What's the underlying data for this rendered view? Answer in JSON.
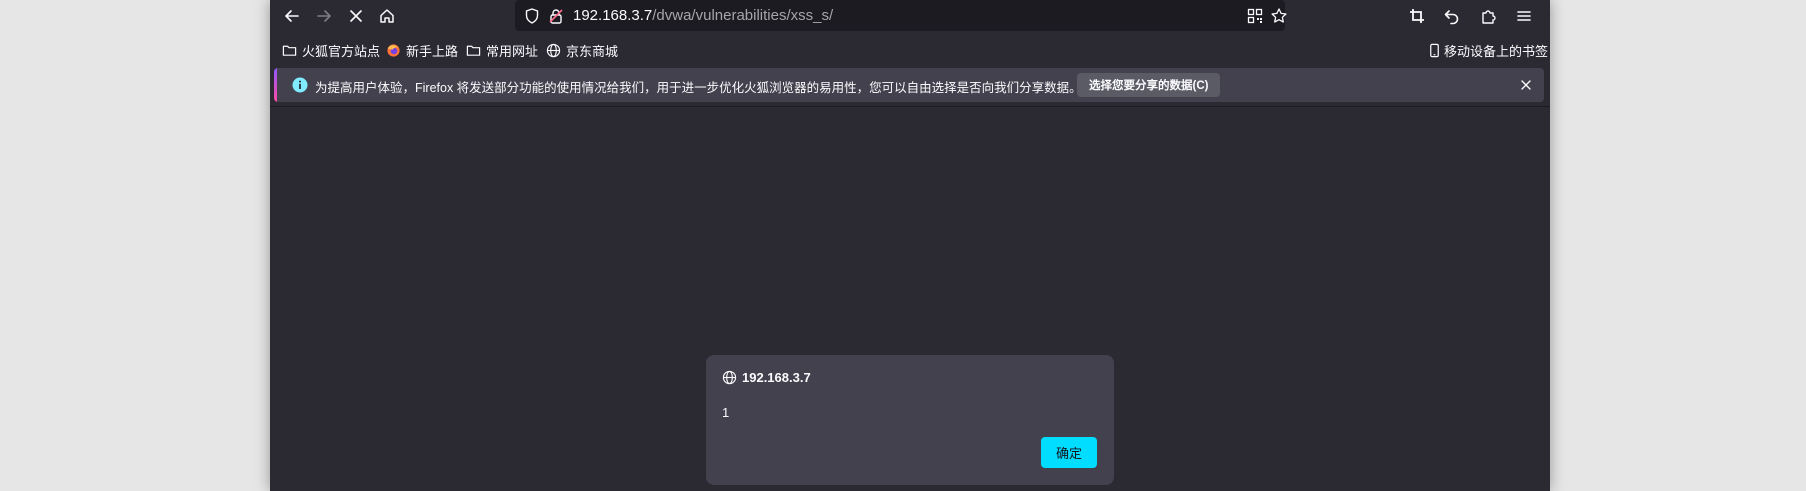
{
  "url": {
    "host": "192.168.3.7",
    "path": "/dvwa/vulnerabilities/xss_s/"
  },
  "bookmarks": {
    "items": [
      {
        "label": "火狐官方站点",
        "icon": "folder-icon"
      },
      {
        "label": "新手上路",
        "icon": "firefox-icon"
      },
      {
        "label": "常用网址",
        "icon": "folder-icon"
      },
      {
        "label": "京东商城",
        "icon": "globe-icon"
      }
    ],
    "mobile_label": "移动设备上的书签"
  },
  "notification": {
    "message": "为提高用户体验，Firefox 将发送部分功能的使用情况给我们，用于进一步优化火狐浏览器的易用性，您可以自由选择是否向我们分享数据。",
    "button_label": "选择您要分享的数据(C)"
  },
  "dialog": {
    "title": "192.168.3.7",
    "message": "1",
    "ok_label": "确定"
  },
  "colors": {
    "accent": "#00ddff",
    "background": "#2b2a33",
    "panel": "#42414d"
  }
}
